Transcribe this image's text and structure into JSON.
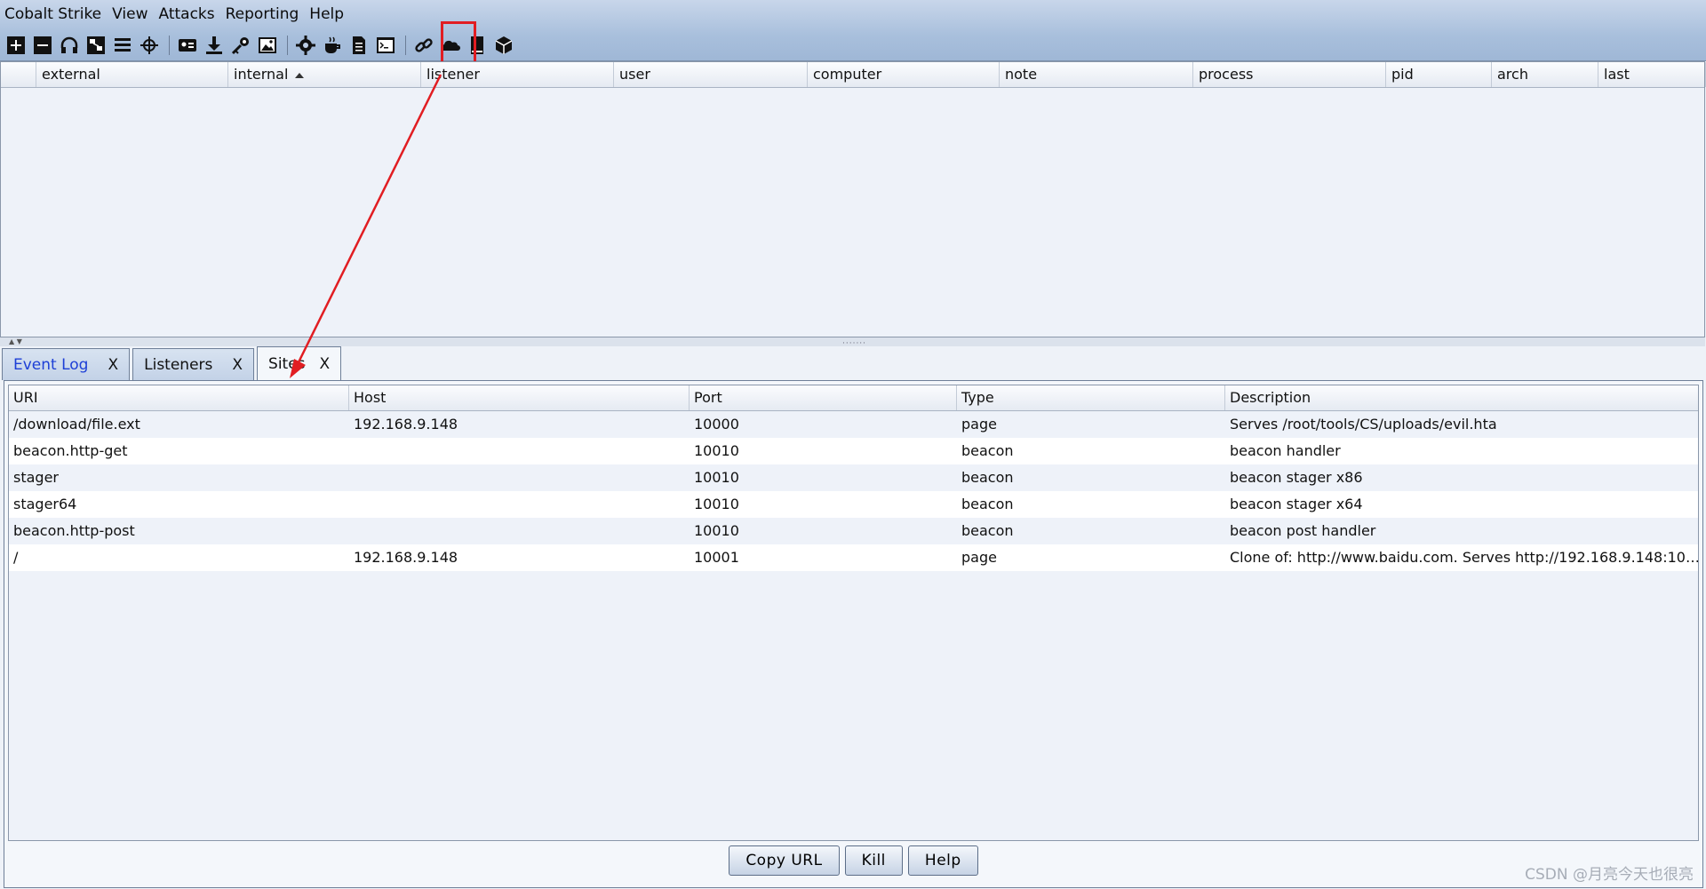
{
  "menu": [
    "Cobalt Strike",
    "View",
    "Attacks",
    "Reporting",
    "Help"
  ],
  "toolbar_icons": [
    "new-connection-icon",
    "disconnect-icon",
    "headphones-icon",
    "pivot-graph-icon",
    "session-table-icon",
    "targets-icon",
    "sep",
    "credentials-icon",
    "downloads-icon",
    "keystrokes-icon",
    "screenshots-icon",
    "sep",
    "gear-icon",
    "java-icon",
    "document-icon",
    "console-icon",
    "sep",
    "link-icon",
    "cloud-icon",
    "book-icon",
    "package-icon"
  ],
  "upper_table": {
    "columns": [
      "",
      "external",
      "internal",
      "listener",
      "user",
      "computer",
      "note",
      "process",
      "pid",
      "arch",
      "last"
    ]
  },
  "tabs": [
    {
      "label": "Event Log",
      "close": "X"
    },
    {
      "label": "Listeners",
      "close": "X"
    },
    {
      "label": "Sites",
      "close": "X"
    }
  ],
  "sites": {
    "columns": [
      "URI",
      "Host",
      "Port",
      "Type",
      "Description"
    ],
    "rows": [
      [
        "/download/file.ext",
        "192.168.9.148",
        "10000",
        "page",
        "Serves /root/tools/CS/uploads/evil.hta"
      ],
      [
        "beacon.http-get",
        "",
        "10010",
        "beacon",
        "beacon handler"
      ],
      [
        "stager",
        "",
        "10010",
        "beacon",
        "beacon stager x86"
      ],
      [
        "stager64",
        "",
        "10010",
        "beacon",
        "beacon stager x64"
      ],
      [
        "beacon.http-post",
        "",
        "10010",
        "beacon",
        "beacon post handler"
      ],
      [
        "/",
        "192.168.9.148",
        "10001",
        "page",
        "Clone of: http://www.baidu.com. Serves http://192.168.9.148:100..."
      ]
    ]
  },
  "buttons": [
    "Copy URL",
    "Kill",
    "Help"
  ],
  "watermark": "CSDN @月亮今天也很亮",
  "colors": {
    "highlight": "#e11d22"
  }
}
